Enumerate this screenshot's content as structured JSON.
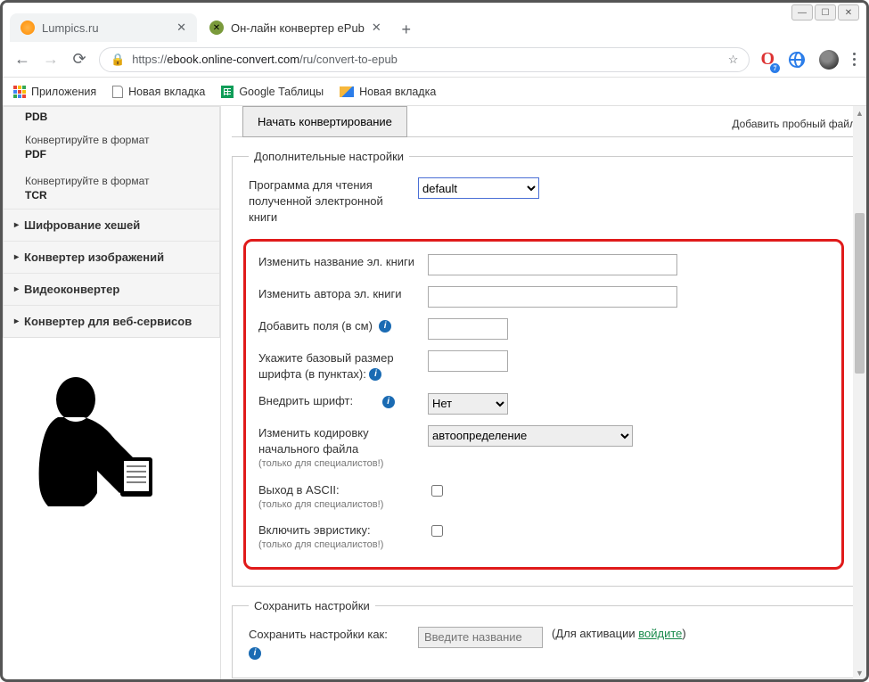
{
  "window": {
    "tabs": [
      {
        "title": "Lumpics.ru",
        "active": false
      },
      {
        "title": "Он-лайн конвертер ePub",
        "active": true
      }
    ],
    "url_prefix": "https://",
    "url_host": "ebook.online-convert.com",
    "url_path": "/ru/convert-to-epub"
  },
  "bookmarks": {
    "apps": "Приложения",
    "items": [
      "Новая вкладка",
      "Google Таблицы",
      "Новая вкладка"
    ]
  },
  "sidebar": {
    "cut": "PDB",
    "items": [
      {
        "text": "Конвертируйте в формат",
        "bold": "PDF"
      },
      {
        "text": "Конвертируйте в формат",
        "bold": "TCR"
      }
    ],
    "expand": [
      "Шифрование хешей",
      "Конвертер изображений",
      "Видеоконвертер",
      "Конвертер для веб-сервисов"
    ]
  },
  "main": {
    "start_btn": "Начать конвертирование",
    "trial": "Добавить пробный файл",
    "add_legend": "Дополнительные настройки",
    "reader_label": "Программа для чтения полученной электронной книги",
    "reader_value": "default",
    "rows": {
      "title_label": "Изменить название эл. книги",
      "author_label": "Изменить автора эл. книги",
      "margin_label": "Добавить поля (в см)",
      "font_label": "Укажите базовый размер шрифта (в пунктах):",
      "embed_label": "Внедрить шрифт:",
      "embed_value": "Нет",
      "encoding_label": "Изменить кодировку начального файла",
      "encoding_hint": "(только для специалистов!)",
      "encoding_value": "автоопределение",
      "ascii_label": "Выход в ASCII:",
      "ascii_hint": "(только для специалистов!)",
      "heur_label": "Включить эвристику:",
      "heur_hint": "(только для специалистов!)"
    },
    "save_legend": "Сохранить настройки",
    "save_label": "Сохранить настройки как:",
    "save_placeholder": "Введите название",
    "activate_pre": "(Для активации ",
    "activate_link": "войдите",
    "activate_post": ")"
  }
}
